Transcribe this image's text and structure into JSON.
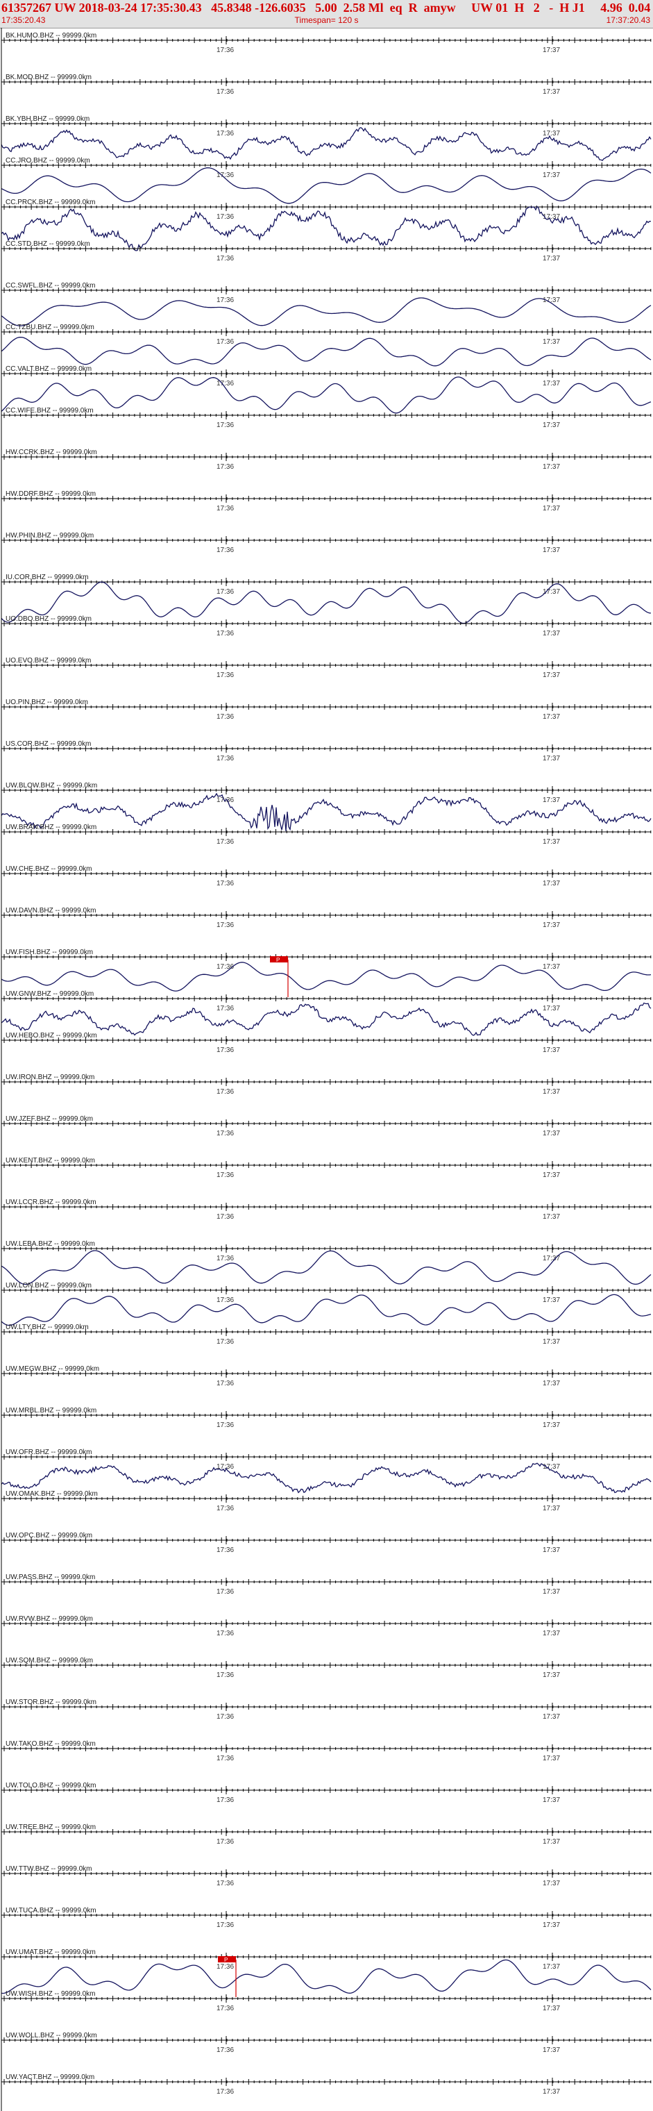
{
  "header": {
    "title_line": "61357267 UW 2018-03-24 17:35:30.43   45.8348 -126.6035   5.00  2.58 Ml  eq  R  amyw     UW 01  H   2   -  H J1     4.96  0.04",
    "start_time": "17:35:20.43",
    "end_time": "17:37:20.43",
    "timespan_label": "Timespan= 120 s"
  },
  "time_marks": [
    "17:36",
    "17:37"
  ],
  "colors": {
    "trace": "#14145e",
    "pick": "#d40000",
    "label": "#1a1a1a",
    "axis": "#000000"
  },
  "pick_marker_label": "P",
  "channels": [
    {
      "label": "BK.HUMO.BHZ -- 99999.0km",
      "trace": false
    },
    {
      "label": "BK.MOD.BHZ -- 99999.0km",
      "trace": false
    },
    {
      "label": "BK.YBH.BHZ -- 99999.0km",
      "trace": true
    },
    {
      "label": "CC.JRO.BHZ -- 99999.0km",
      "trace": true
    },
    {
      "label": "CC.PRCK.BHZ -- 99999.0km",
      "trace": true
    },
    {
      "label": "CC.STD.BHZ -- 99999.0km",
      "trace": false
    },
    {
      "label": "CC.SWFL.BHZ -- 99999.0km",
      "trace": true
    },
    {
      "label": "CC.TZBU.BHZ -- 99999.0km",
      "trace": true
    },
    {
      "label": "CC.VALT.BHZ -- 99999.0km",
      "trace": true
    },
    {
      "label": "CC.WIFE.BHZ -- 99999.0km",
      "trace": false
    },
    {
      "label": "HW.CCRK.BHZ -- 99999.0km",
      "trace": false
    },
    {
      "label": "HW.DDRF.BHZ -- 99999.0km",
      "trace": false
    },
    {
      "label": "HW.PHIN.BHZ -- 99999.0km",
      "trace": false
    },
    {
      "label": "IU.COR.BHZ -- 99999.0km",
      "trace": true
    },
    {
      "label": "UO.DBO.BHZ -- 99999.0km",
      "trace": false
    },
    {
      "label": "UO.EVO.BHZ -- 99999.0km",
      "trace": false
    },
    {
      "label": "UO.PIN.BHZ -- 99999.0km",
      "trace": false
    },
    {
      "label": "US.COR.BHZ -- 99999.0km",
      "trace": false
    },
    {
      "label": "UW.BLOW.BHZ -- 99999.0km",
      "trace": true
    },
    {
      "label": "UW.BRAN.BHZ -- 99999.0km",
      "trace": false
    },
    {
      "label": "UW.CHE.BHZ -- 99999.0km",
      "trace": false
    },
    {
      "label": "UW.DAVN.BHZ -- 99999.0km",
      "trace": false
    },
    {
      "label": "UW.FISH.BHZ -- 99999.0km",
      "trace": true,
      "pick": true
    },
    {
      "label": "UW.GNW.BHZ -- 99999.0km",
      "trace": true
    },
    {
      "label": "UW.HEBO.BHZ -- 99999.0km",
      "trace": false
    },
    {
      "label": "UW.IRON.BHZ -- 99999.0km",
      "trace": false
    },
    {
      "label": "UW.JZEF.BHZ -- 99999.0km",
      "trace": false
    },
    {
      "label": "UW.KENT.BHZ -- 99999.0km",
      "trace": false
    },
    {
      "label": "UW.LCCR.BHZ -- 99999.0km",
      "trace": false
    },
    {
      "label": "UW.LEBA.BHZ -- 99999.0km",
      "trace": true
    },
    {
      "label": "UW.LON.BHZ -- 99999.0km",
      "trace": true
    },
    {
      "label": "UW.LTY.BHZ -- 99999.0km",
      "trace": false
    },
    {
      "label": "UW.MEGW.BHZ -- 99999.0km",
      "trace": false
    },
    {
      "label": "UW.MRBL.BHZ -- 99999.0km",
      "trace": false
    },
    {
      "label": "UW.OFR.BHZ -- 99999.0km",
      "trace": true
    },
    {
      "label": "UW.OMAK.BHZ -- 99999.0km",
      "trace": false
    },
    {
      "label": "UW.OPC.BHZ -- 99999.0km",
      "trace": false
    },
    {
      "label": "UW.PASS.BHZ -- 99999.0km",
      "trace": false
    },
    {
      "label": "UW.RVW.BHZ -- 99999.0km",
      "trace": false
    },
    {
      "label": "UW.SQM.BHZ -- 99999.0km",
      "trace": false
    },
    {
      "label": "UW.STOR.BHZ -- 99999.0km",
      "trace": false
    },
    {
      "label": "UW.TAKO.BHZ -- 99999.0km",
      "trace": false
    },
    {
      "label": "UW.TOLO.BHZ -- 99999.0km",
      "trace": false
    },
    {
      "label": "UW.TREE.BHZ -- 99999.0km",
      "trace": false
    },
    {
      "label": "UW.TTW.BHZ -- 99999.0km",
      "trace": false
    },
    {
      "label": "UW.TUCA.BHZ -- 99999.0km",
      "trace": false
    },
    {
      "label": "UW.UMAT.BHZ -- 99999.0km",
      "trace": true,
      "pick": true
    },
    {
      "label": "UW.WISH.BHZ -- 99999.0km",
      "trace": false
    },
    {
      "label": "UW.WOLL.BHZ -- 99999.0km",
      "trace": false
    },
    {
      "label": "UW.YACT.BHZ -- 99999.0km",
      "trace": false
    }
  ]
}
